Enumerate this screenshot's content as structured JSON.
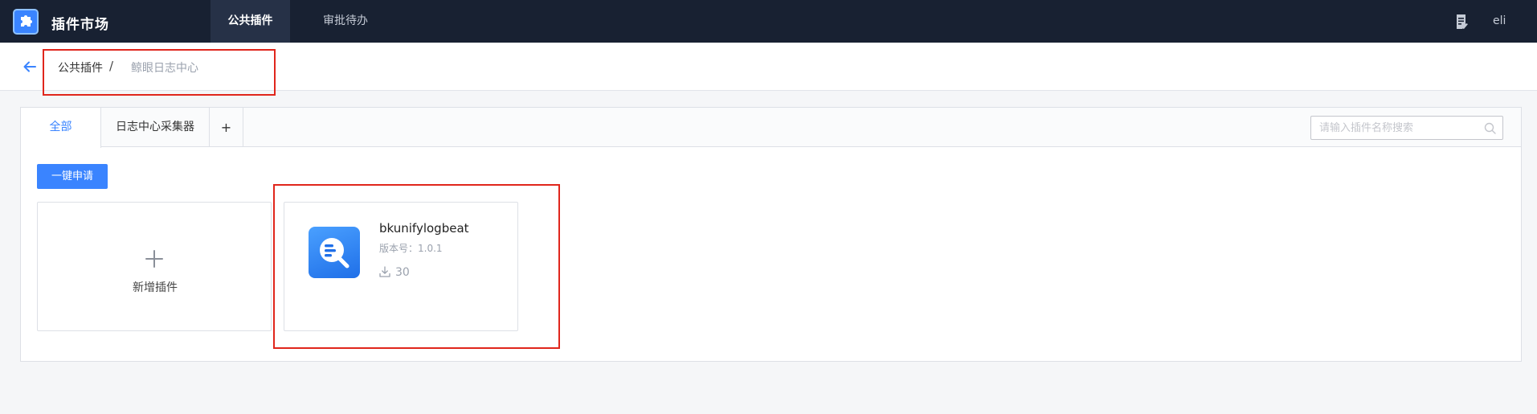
{
  "topbar": {
    "app_title": "插件市场",
    "logo_icon": "puzzle-icon",
    "nav_tabs": [
      {
        "label": "公共插件",
        "active": true
      },
      {
        "label": "审批待办",
        "active": false
      }
    ],
    "user_name": "eli"
  },
  "breadcrumb": {
    "back_icon": "arrow-left-icon",
    "parent": "公共插件",
    "separator": "/",
    "current": "鲸眼日志中心"
  },
  "tabs": [
    {
      "label": "全部",
      "active": true
    },
    {
      "label": "日志中心采集器",
      "active": false
    },
    {
      "label": "+",
      "active": false
    }
  ],
  "search": {
    "placeholder": "请输入插件名称搜索",
    "value": ""
  },
  "apply_button": "一键申请",
  "add_card": {
    "label": "新增插件"
  },
  "plugin": {
    "name": "bkunifylogbeat",
    "version_label": "版本号：",
    "version": "1.0.1",
    "downloads": "30"
  },
  "colors": {
    "accent": "#3a84ff",
    "topbar": "#182132",
    "annotation": "#e0261c"
  }
}
